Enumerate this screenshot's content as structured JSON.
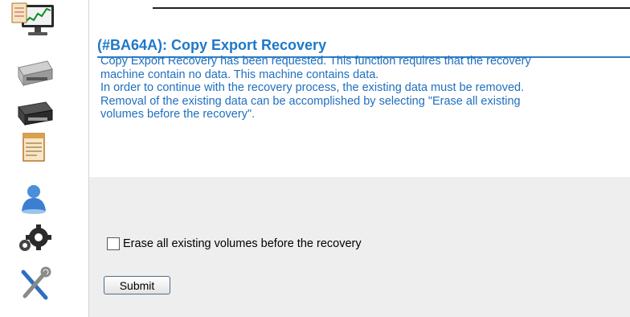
{
  "sidebar": {
    "items": [
      {
        "name": "monitor-icon"
      },
      {
        "name": "tape-drive-icon"
      },
      {
        "name": "tape-library-icon"
      },
      {
        "name": "notepad-icon"
      },
      {
        "name": "user-icon"
      },
      {
        "name": "gears-icon"
      },
      {
        "name": "tools-icon"
      }
    ]
  },
  "main": {
    "title": "(#BA64A): Copy Export Recovery",
    "message_lines": [
      "Copy Export Recovery has been requested. This function requires that the recovery",
      "machine contain no data. This machine contains data.",
      "In order to continue with the recovery process, the existing data must be removed.",
      "Removal of the existing data can be accomplished by selecting \"Erase all existing",
      "volumes before the recovery\"."
    ],
    "checkbox_label": "Erase all existing volumes before the recovery",
    "checkbox_checked": false,
    "submit_label": "Submit"
  },
  "colors": {
    "title": "#1f78c8",
    "message": "#1f6fbf",
    "band": "#eeeeee"
  }
}
